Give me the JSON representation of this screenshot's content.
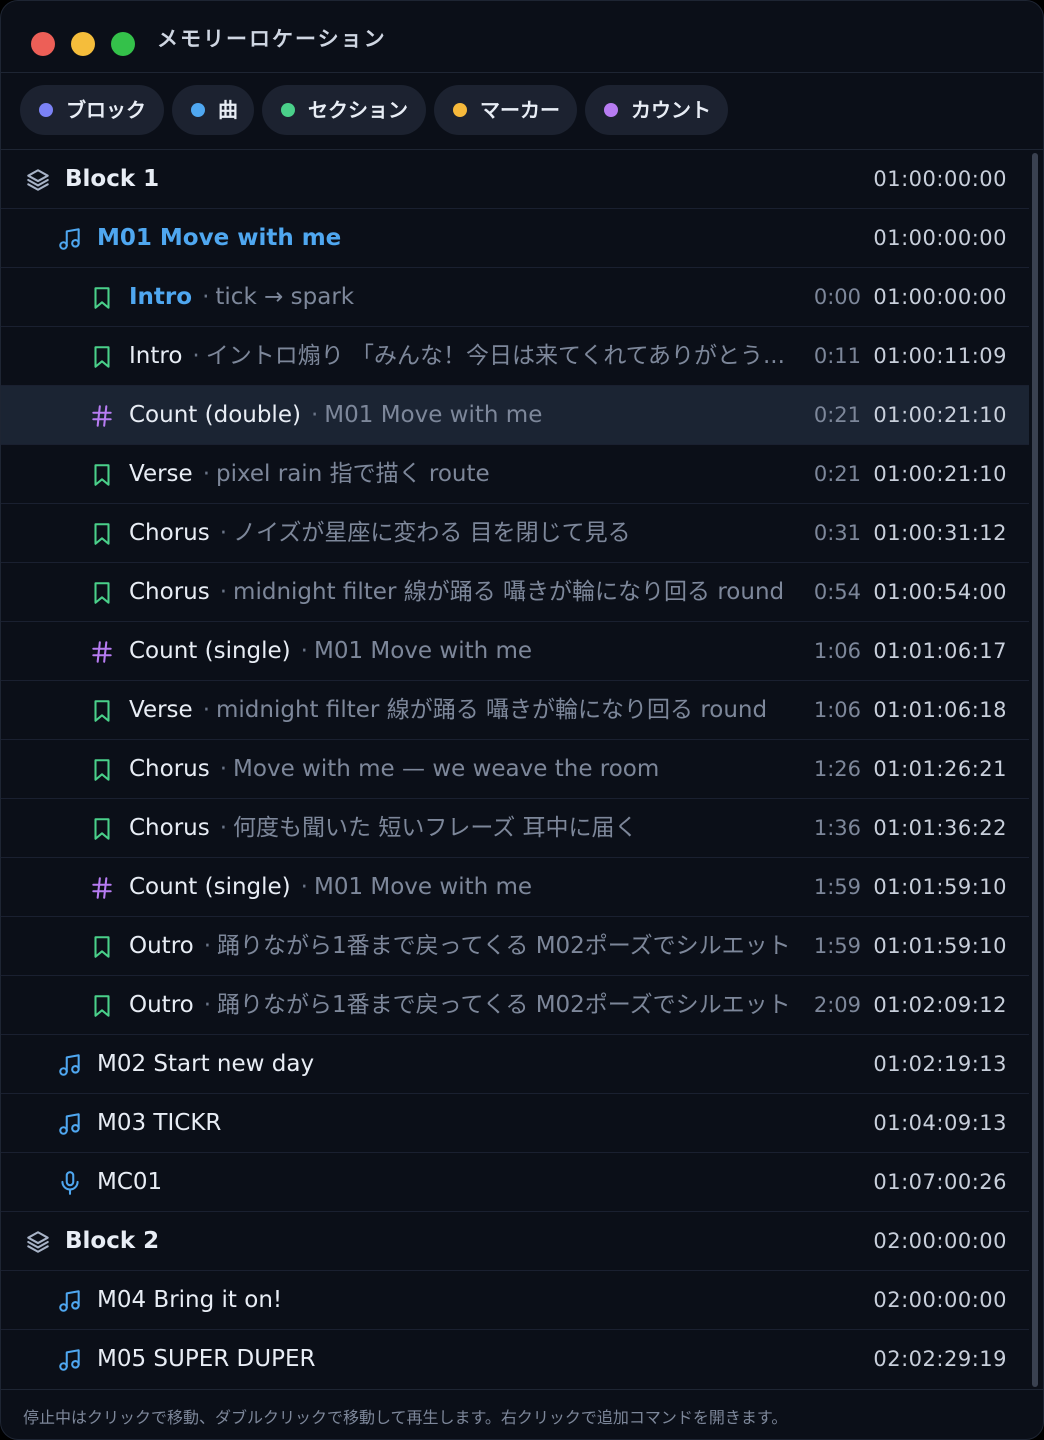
{
  "window": {
    "title": "メモリーロケーション"
  },
  "colors": {
    "block": "#a8b3c7",
    "song": "#4fa7f0",
    "section": "#4ad08a",
    "marker": "#f6b93b",
    "count": "#b77cf2",
    "mic": "#4fa7f0"
  },
  "filters": [
    {
      "label": "ブロック",
      "color": "#7b82f5"
    },
    {
      "label": "曲",
      "color": "#4fa7f0"
    },
    {
      "label": "セクション",
      "color": "#4ad08a"
    },
    {
      "label": "マーカー",
      "color": "#f6b93b"
    },
    {
      "label": "カウント",
      "color": "#b77cf2"
    }
  ],
  "rows": [
    {
      "kind": "block",
      "icon": "layers-icon",
      "name": "Block 1",
      "note": "",
      "rel": "",
      "tc": "01:00:00:00"
    },
    {
      "kind": "song",
      "icon": "music-note-icon",
      "name": "M01 Move with me",
      "note": "",
      "rel": "",
      "tc": "01:00:00:00",
      "highlight": true
    },
    {
      "kind": "section",
      "icon": "bookmark-icon",
      "name": "Intro",
      "note": "tick → spark",
      "rel": "0:00",
      "tc": "01:00:00:00",
      "highlight": true
    },
    {
      "kind": "section",
      "icon": "bookmark-icon",
      "name": "Intro",
      "note": "イントロ煽り 「みんな！今日は来てくれてありがとう...",
      "rel": "0:11",
      "tc": "01:00:11:09"
    },
    {
      "kind": "count",
      "icon": "hash-icon",
      "name": "Count (double)",
      "note": "M01 Move with me",
      "rel": "0:21",
      "tc": "01:00:21:10",
      "selected": true
    },
    {
      "kind": "section",
      "icon": "bookmark-icon",
      "name": "Verse",
      "note": "pixel rain 指で描く route",
      "rel": "0:21",
      "tc": "01:00:21:10"
    },
    {
      "kind": "section",
      "icon": "bookmark-icon",
      "name": "Chorus",
      "note": "ノイズが星座に変わる 目を閉じて見る",
      "rel": "0:31",
      "tc": "01:00:31:12"
    },
    {
      "kind": "section",
      "icon": "bookmark-icon",
      "name": "Chorus",
      "note": "midnight filter 線が踊る 囁きが輪になり回る round",
      "rel": "0:54",
      "tc": "01:00:54:00"
    },
    {
      "kind": "count",
      "icon": "hash-icon",
      "name": "Count (single)",
      "note": "M01 Move with me",
      "rel": "1:06",
      "tc": "01:01:06:17"
    },
    {
      "kind": "section",
      "icon": "bookmark-icon",
      "name": "Verse",
      "note": "midnight filter 線が踊る 囁きが輪になり回る round",
      "rel": "1:06",
      "tc": "01:01:06:18"
    },
    {
      "kind": "section",
      "icon": "bookmark-icon",
      "name": "Chorus",
      "note": "Move with me — we weave the room",
      "rel": "1:26",
      "tc": "01:01:26:21"
    },
    {
      "kind": "section",
      "icon": "bookmark-icon",
      "name": "Chorus",
      "note": "何度も聞いた 短いフレーズ 耳中に届く",
      "rel": "1:36",
      "tc": "01:01:36:22"
    },
    {
      "kind": "count",
      "icon": "hash-icon",
      "name": "Count (single)",
      "note": "M01 Move with me",
      "rel": "1:59",
      "tc": "01:01:59:10"
    },
    {
      "kind": "section",
      "icon": "bookmark-icon",
      "name": "Outro",
      "note": "踊りながら1番まで戻ってくる M02ポーズでシルエット",
      "rel": "1:59",
      "tc": "01:01:59:10"
    },
    {
      "kind": "section",
      "icon": "bookmark-icon",
      "name": "Outro",
      "note": "踊りながら1番まで戻ってくる M02ポーズでシルエット",
      "rel": "2:09",
      "tc": "01:02:09:12"
    },
    {
      "kind": "song",
      "icon": "music-note-icon",
      "name": "M02 Start new day",
      "note": "",
      "rel": "",
      "tc": "01:02:19:13"
    },
    {
      "kind": "song",
      "icon": "music-note-icon",
      "name": "M03 TICKR",
      "note": "",
      "rel": "",
      "tc": "01:04:09:13"
    },
    {
      "kind": "mic",
      "icon": "microphone-icon",
      "name": "MC01",
      "note": "",
      "rel": "",
      "tc": "01:07:00:26"
    },
    {
      "kind": "block",
      "icon": "layers-icon",
      "name": "Block 2",
      "note": "",
      "rel": "",
      "tc": "02:00:00:00"
    },
    {
      "kind": "song",
      "icon": "music-note-icon",
      "name": "M04 Bring it on!",
      "note": "",
      "rel": "",
      "tc": "02:00:00:00"
    },
    {
      "kind": "song",
      "icon": "music-note-icon",
      "name": "M05 SUPER DUPER",
      "note": "",
      "rel": "",
      "tc": "02:02:29:19"
    }
  ],
  "footer": {
    "hint": "停止中はクリックで移動、ダブルクリックで移動して再生します。右クリックで追加コマンドを開きます。"
  }
}
